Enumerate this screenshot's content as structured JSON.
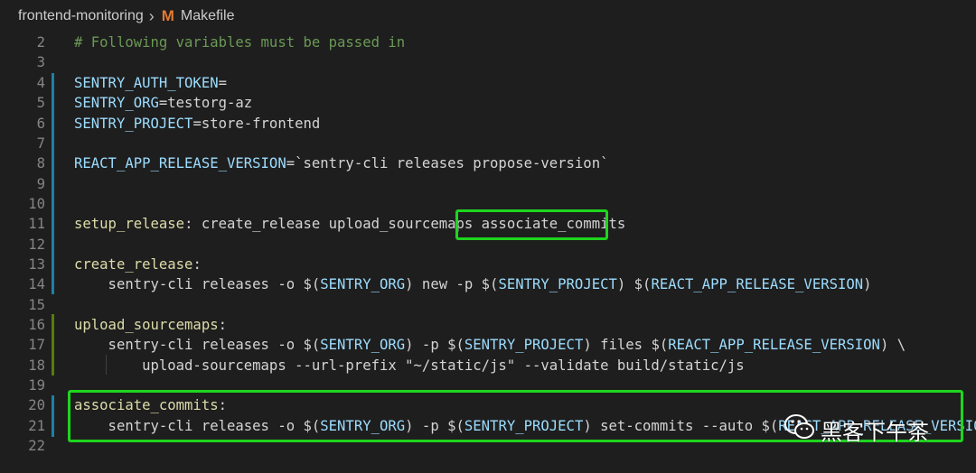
{
  "breadcrumb": {
    "folder": "frontend-monitoring",
    "separator": "›",
    "file_icon": "M",
    "file": "Makefile"
  },
  "lines": [
    {
      "num": "2",
      "segments": [
        {
          "t": "# Following variables must be passed in",
          "c": "comment"
        }
      ]
    },
    {
      "num": "3",
      "segments": []
    },
    {
      "num": "4",
      "segments": [
        {
          "t": "SENTRY_AUTH_TOKEN",
          "c": "var"
        },
        {
          "t": "=",
          "c": "plain"
        }
      ]
    },
    {
      "num": "5",
      "segments": [
        {
          "t": "SENTRY_ORG",
          "c": "var"
        },
        {
          "t": "=testorg-az",
          "c": "plain"
        }
      ]
    },
    {
      "num": "6",
      "segments": [
        {
          "t": "SENTRY_PROJECT",
          "c": "var"
        },
        {
          "t": "=store-frontend",
          "c": "plain"
        }
      ]
    },
    {
      "num": "7",
      "segments": []
    },
    {
      "num": "8",
      "segments": [
        {
          "t": "REACT_APP_RELEASE_VERSION",
          "c": "var"
        },
        {
          "t": "=`sentry-cli releases propose-version`",
          "c": "plain"
        }
      ]
    },
    {
      "num": "9",
      "segments": []
    },
    {
      "num": "10",
      "segments": []
    },
    {
      "num": "11",
      "segments": [
        {
          "t": "setup_release",
          "c": "target"
        },
        {
          "t": ": create_release upload_sourcemaps associate_commits",
          "c": "plain"
        }
      ]
    },
    {
      "num": "12",
      "segments": []
    },
    {
      "num": "13",
      "segments": [
        {
          "t": "create_release",
          "c": "target"
        },
        {
          "t": ":",
          "c": "plain"
        }
      ]
    },
    {
      "num": "14",
      "segments": [
        {
          "t": "    sentry-cli releases -o ",
          "c": "plain"
        },
        {
          "t": "$(",
          "c": "plain"
        },
        {
          "t": "SENTRY_ORG",
          "c": "var"
        },
        {
          "t": ") new -p ",
          "c": "plain"
        },
        {
          "t": "$(",
          "c": "plain"
        },
        {
          "t": "SENTRY_PROJECT",
          "c": "var"
        },
        {
          "t": ") ",
          "c": "plain"
        },
        {
          "t": "$(",
          "c": "plain"
        },
        {
          "t": "REACT_APP_RELEASE_VERSION",
          "c": "var"
        },
        {
          "t": ")",
          "c": "plain"
        }
      ]
    },
    {
      "num": "15",
      "segments": []
    },
    {
      "num": "16",
      "segments": [
        {
          "t": "upload_sourcemaps",
          "c": "target"
        },
        {
          "t": ":",
          "c": "plain"
        }
      ]
    },
    {
      "num": "17",
      "segments": [
        {
          "t": "    sentry-cli releases -o ",
          "c": "plain"
        },
        {
          "t": "$(",
          "c": "plain"
        },
        {
          "t": "SENTRY_ORG",
          "c": "var"
        },
        {
          "t": ") -p ",
          "c": "plain"
        },
        {
          "t": "$(",
          "c": "plain"
        },
        {
          "t": "SENTRY_PROJECT",
          "c": "var"
        },
        {
          "t": ") files ",
          "c": "plain"
        },
        {
          "t": "$(",
          "c": "plain"
        },
        {
          "t": "REACT_APP_RELEASE_VERSION",
          "c": "var"
        },
        {
          "t": ") \\",
          "c": "plain"
        }
      ]
    },
    {
      "num": "18",
      "segments": [
        {
          "t": "        upload-sourcemaps --url-prefix \"~/static/js\" --validate build/static/js",
          "c": "plain"
        }
      ]
    },
    {
      "num": "19",
      "segments": []
    },
    {
      "num": "20",
      "segments": [
        {
          "t": "associate_commits",
          "c": "target"
        },
        {
          "t": ":",
          "c": "plain"
        }
      ]
    },
    {
      "num": "21",
      "segments": [
        {
          "t": "    sentry-cli releases -o ",
          "c": "plain"
        },
        {
          "t": "$(",
          "c": "plain"
        },
        {
          "t": "SENTRY_ORG",
          "c": "var"
        },
        {
          "t": ") -p ",
          "c": "plain"
        },
        {
          "t": "$(",
          "c": "plain"
        },
        {
          "t": "SENTRY_PROJECT",
          "c": "var"
        },
        {
          "t": ") set-commits --auto ",
          "c": "plain"
        },
        {
          "t": "$(",
          "c": "plain"
        },
        {
          "t": "REACT_APP_RELEASE_VERSION",
          "c": "var"
        },
        {
          "t": ")",
          "c": "plain"
        }
      ]
    },
    {
      "num": "22",
      "segments": []
    }
  ],
  "watermark": {
    "icon": "wechat-icon",
    "text": "黑客下午茶"
  },
  "colors": {
    "background": "#1e1e1e",
    "highlight_box": "#1ed51e",
    "gutter_modified": "#1b81a8",
    "gutter_added": "#587c0c"
  }
}
